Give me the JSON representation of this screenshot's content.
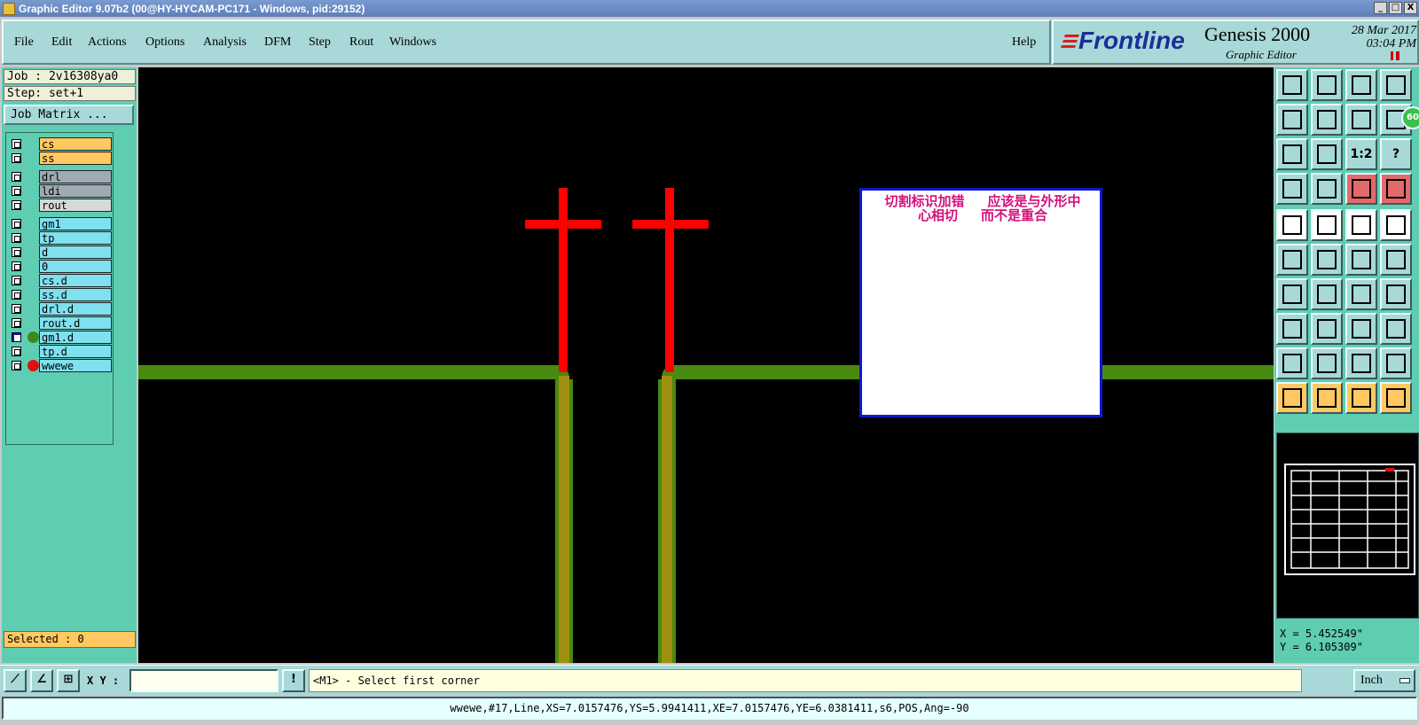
{
  "window": {
    "title": "Graphic Editor 9.07b2 (00@HY-HYCAM-PC171 - Windows, pid:29152)",
    "controls": [
      "_",
      "□",
      "X"
    ]
  },
  "menu": [
    "File",
    "Edit",
    "Actions",
    "Options",
    "Analysis",
    "DFM",
    "Step",
    "Rout",
    "Windows"
  ],
  "help_label": "Help",
  "logo": {
    "brand": "Frontline",
    "product": "Genesis 2000",
    "subtitle": "Graphic Editor",
    "date": "28 Mar 2017",
    "time": "03:04 PM"
  },
  "job": {
    "job_label": "Job : 2v16308ya0",
    "step_label": "Step: set+1",
    "matrix_button": "Job Matrix ..."
  },
  "layers": [
    {
      "name": "cs",
      "bg": "#ffc860",
      "checked": false,
      "dot": ""
    },
    {
      "name": "ss",
      "bg": "#ffc860",
      "checked": false,
      "dot": ""
    },
    {
      "name": "drl",
      "bg": "#a0aab4",
      "checked": false,
      "dot": ""
    },
    {
      "name": "ldi",
      "bg": "#a0aab4",
      "checked": false,
      "dot": ""
    },
    {
      "name": "rout",
      "bg": "#d8d8d8",
      "checked": false,
      "dot": ""
    },
    {
      "name": "gm1",
      "bg": "#7fe0f0",
      "checked": false,
      "dot": ""
    },
    {
      "name": "tp",
      "bg": "#7fe0f0",
      "checked": false,
      "dot": ""
    },
    {
      "name": "d",
      "bg": "#7fe0f0",
      "checked": false,
      "dot": ""
    },
    {
      "name": "0",
      "bg": "#7fe0f0",
      "checked": false,
      "dot": ""
    },
    {
      "name": "cs.d",
      "bg": "#7fe0f0",
      "checked": false,
      "dot": ""
    },
    {
      "name": "ss.d",
      "bg": "#7fe0f0",
      "checked": false,
      "dot": ""
    },
    {
      "name": "drl.d",
      "bg": "#7fe0f0",
      "checked": false,
      "dot": ""
    },
    {
      "name": "rout.d",
      "bg": "#7fe0f0",
      "checked": false,
      "dot": ""
    },
    {
      "name": "gm1.d",
      "bg": "#7fe0f0",
      "checked": true,
      "dot": "#3a8a1a"
    },
    {
      "name": "tp.d",
      "bg": "#7fe0f0",
      "checked": false,
      "dot": ""
    },
    {
      "name": "wwewe",
      "bg": "#7fe0f0",
      "checked": false,
      "dot": "#e01010"
    }
  ],
  "selected_label": "Selected : 0",
  "note": "切割标识加错     应该是与外形中\n心相切     而不是重合",
  "tools": [
    {
      "icon": "zoom-home-icon",
      "style": ""
    },
    {
      "icon": "zoom-down-icon",
      "style": ""
    },
    {
      "icon": "home-icon",
      "style": ""
    },
    {
      "icon": "split-view-icon",
      "style": ""
    },
    {
      "icon": "pan-left-icon",
      "style": ""
    },
    {
      "icon": "pan-right-icon",
      "style": ""
    },
    {
      "icon": "undo-zoom-icon",
      "style": ""
    },
    {
      "icon": "measure-icon",
      "style": ""
    },
    {
      "icon": "fit-screen-icon",
      "style": ""
    },
    {
      "icon": "zoom-fit-icon",
      "style": ""
    },
    {
      "icon": "one-to-two-icon",
      "style": "",
      "text": "1:2"
    },
    {
      "icon": "help-icon",
      "style": "",
      "text": "?"
    },
    {
      "icon": "snap-icon",
      "style": ""
    },
    {
      "icon": "grid-icon",
      "style": ""
    },
    {
      "icon": "layer-compare-icon",
      "style": "red"
    },
    {
      "icon": "layer-compare-2-icon",
      "style": "red"
    },
    {
      "icon": "pad-icon",
      "style": "white"
    },
    {
      "icon": "surface-icon",
      "style": "white"
    },
    {
      "icon": "ruler-icon",
      "style": "white"
    },
    {
      "icon": "dot-icon",
      "style": "white"
    },
    {
      "icon": "connect-icon",
      "style": ""
    },
    {
      "icon": "cross-icon",
      "style": ""
    },
    {
      "icon": "line-endpoint-icon",
      "style": ""
    },
    {
      "icon": "line-endpoint-2-icon",
      "style": ""
    },
    {
      "icon": "angle-icon",
      "style": ""
    },
    {
      "icon": "diagonal-icon",
      "style": ""
    },
    {
      "icon": "rotate-icon",
      "style": ""
    },
    {
      "icon": "mirror-icon",
      "style": ""
    },
    {
      "icon": "pad-add-icon",
      "style": ""
    },
    {
      "icon": "line-add-icon",
      "style": ""
    },
    {
      "icon": "dimension-icon",
      "style": ""
    },
    {
      "icon": "array-icon",
      "style": ""
    },
    {
      "icon": "arc-1-icon",
      "style": ""
    },
    {
      "icon": "arc-2-icon",
      "style": ""
    },
    {
      "icon": "arc-3-icon",
      "style": ""
    },
    {
      "icon": "arc-4-icon",
      "style": ""
    },
    {
      "icon": "select-arrow-icon",
      "style": "yellow"
    },
    {
      "icon": "select-box-icon",
      "style": "yellow"
    },
    {
      "icon": "select-circle-icon",
      "style": "yellow"
    },
    {
      "icon": "select-path-icon",
      "style": "yellow"
    }
  ],
  "green_circle": "60",
  "coords": {
    "x": "X = 5.452549\"",
    "y": "Y = 6.105309\""
  },
  "cmd": {
    "xy_label": "X Y :",
    "xy_value": "",
    "warn_label": "!",
    "prompt": "<M1> - Select first corner",
    "units": "Inch"
  },
  "status": "wwewe,#17,Line,XS=7.0157476,YS=5.9941411,XE=7.0157476,YE=6.0381411,s6,POS,Ang=-90",
  "colors": {
    "trace": "#4a8a10",
    "pad_overlap": "#a09010",
    "marker": "#ff0000"
  }
}
